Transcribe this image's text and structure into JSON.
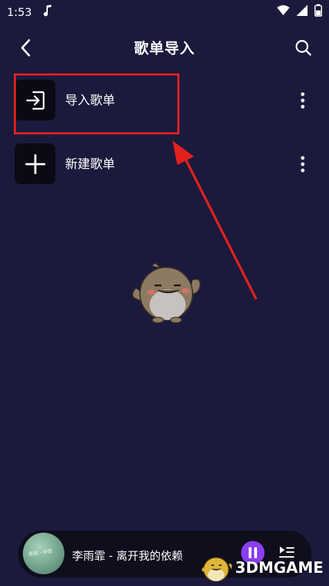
{
  "status_bar": {
    "time": "1:53",
    "icons": [
      "music-note-icon",
      "wifi-icon",
      "signal-icon",
      "battery-icon"
    ]
  },
  "header": {
    "title": "歌单导入",
    "back_icon": "chevron-left-icon",
    "search_icon": "search-icon"
  },
  "list": {
    "items": [
      {
        "label": "导入歌单",
        "icon": "import-icon"
      },
      {
        "label": "新建歌单",
        "icon": "plus-icon"
      }
    ]
  },
  "player": {
    "song": "李雨霏 - 离开我的依赖",
    "album_art_text": "寄宿 - 钟爱"
  },
  "watermark": {
    "text": "3DMGAME"
  },
  "colors": {
    "background": "#1c1a3c",
    "highlight": "#e3211c",
    "play_button": "#8b3df0"
  }
}
